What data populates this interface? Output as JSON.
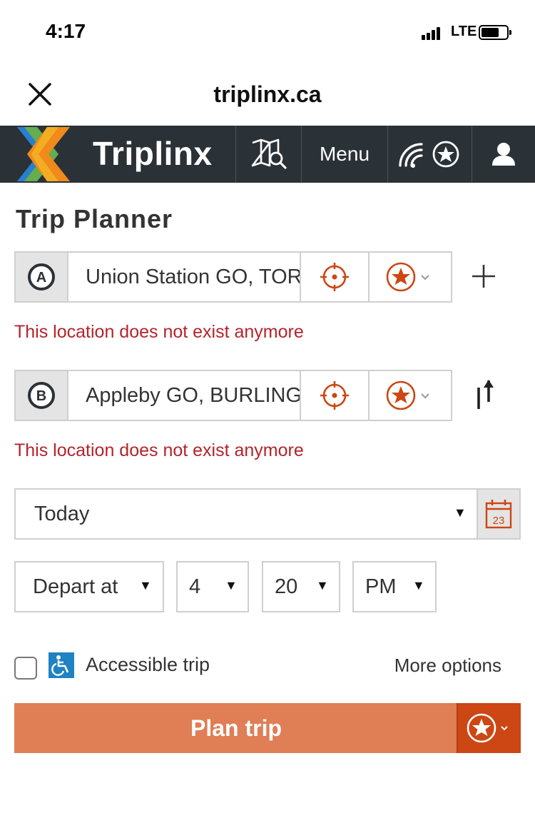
{
  "status_bar": {
    "time": "4:17",
    "network": "LTE"
  },
  "browser": {
    "url": "triplinx.ca",
    "close_icon": "close-icon"
  },
  "nav": {
    "logo_text": "Triplinx",
    "map_icon": "map-search-icon",
    "menu_label": "Menu",
    "favorites_icon": "realtime-favorites-icon",
    "user_icon": "user-icon"
  },
  "planner": {
    "title": "Trip Planner",
    "origin": {
      "badge": "A",
      "value": "Union Station GO, TORONTO",
      "error": "This location does not exist anymore"
    },
    "destination": {
      "badge": "B",
      "value": "Appleby GO, BURLINGTON",
      "error": "This location does not exist anymore"
    },
    "date": {
      "selected": "Today",
      "calendar_day": "23"
    },
    "time": {
      "mode": "Depart at",
      "hour": "4",
      "minute": "20",
      "ampm": "PM"
    },
    "accessible_label": "Accessible trip",
    "accessible_checked": false,
    "more_options": "More options",
    "plan_button": "Plan trip"
  },
  "colors": {
    "nav_bg": "#2b3237",
    "accent": "#cc4713",
    "button": "#e07e55",
    "error": "#b5232b",
    "accessible": "#1f83c3"
  }
}
